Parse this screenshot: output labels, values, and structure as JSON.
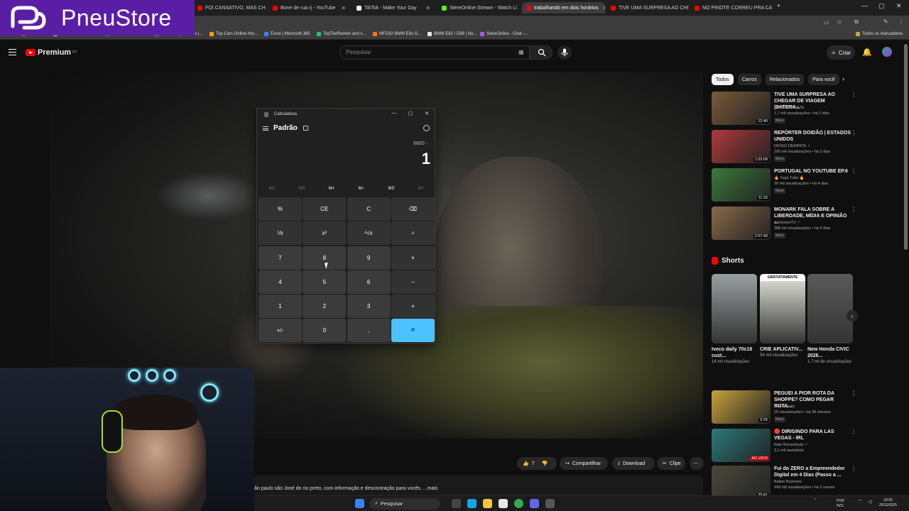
{
  "logo": {
    "text": "PneuStore"
  },
  "tabs": [
    {
      "label": "FOI CANSATIVO, MAS CHEGAM",
      "color": "#ff0000"
    },
    {
      "label": "Bone de rua rj - YouTube",
      "color": "#ff0000"
    },
    {
      "label": "TikTok - Make Your Day",
      "color": "#ffffff"
    },
    {
      "label": "StereOnline Stream - Watch Li",
      "color": "#53fc18"
    },
    {
      "label": "trabalhando em dois horários",
      "color": "#ff0000"
    },
    {
      "label": "TIVE UMA SURPRESA AO CHE",
      "color": "#ff0000"
    },
    {
      "label": "NO PINOTE CORREU PRA CASA",
      "color": "#ff0000"
    }
  ],
  "bookmarks": [
    {
      "label": "Gmail",
      "color": "#ea4335"
    },
    {
      "label": "FIAT-1085 Malas...",
      "color": "#cccccc"
    },
    {
      "label": "Li Mails v2.0 Fair ob...",
      "color": "#1a73e8"
    },
    {
      "label": "StreamingServices |...",
      "color": "#8b5cf6"
    },
    {
      "label": "Top Cars Online Hor...",
      "color": "#f59e0b"
    },
    {
      "label": "Excel | Microsoft 365",
      "color": "#3b82f6"
    },
    {
      "label": "TopTierRamen and s...",
      "color": "#22c55e"
    },
    {
      "label": "MFD32 BMW E8x G...",
      "color": "#f97316"
    },
    {
      "label": "BMW E82 / E88 | No...",
      "color": "#e5e7eb"
    },
    {
      "label": "StereOnline - Chat -...",
      "color": "#a855f7"
    }
  ],
  "bookmarks_all": "Todos os marcadores",
  "youtube": {
    "brand": "Premium",
    "region": "PT",
    "search_placeholder": "Pesquisar",
    "create_label": "Criar"
  },
  "calculator": {
    "title": "Calculadora",
    "mode": "Padrão",
    "expression": "6600 -",
    "display": "1",
    "memory": [
      {
        "label": "MC",
        "enabled": false
      },
      {
        "label": "MR",
        "enabled": false
      },
      {
        "label": "M+",
        "enabled": true
      },
      {
        "label": "M−",
        "enabled": true
      },
      {
        "label": "MS",
        "enabled": true
      },
      {
        "label": "M˅",
        "enabled": false
      }
    ],
    "keys": [
      {
        "label": "%",
        "name": "percent-key",
        "kind": "fn"
      },
      {
        "label": "CE",
        "name": "clear-entry-key",
        "kind": "fn"
      },
      {
        "label": "C",
        "name": "clear-key",
        "kind": "fn"
      },
      {
        "label": "⌫",
        "name": "backspace-key",
        "kind": "fn"
      },
      {
        "label": "⅟x",
        "name": "reciprocal-key",
        "kind": "fn"
      },
      {
        "label": "x²",
        "name": "square-key",
        "kind": "fn"
      },
      {
        "label": "²√x",
        "name": "sqrt-key",
        "kind": "fn"
      },
      {
        "label": "÷",
        "name": "divide-key",
        "kind": "fn"
      },
      {
        "label": "7",
        "name": "digit-7-key",
        "kind": "num"
      },
      {
        "label": "8",
        "name": "digit-8-key",
        "kind": "num"
      },
      {
        "label": "9",
        "name": "digit-9-key",
        "kind": "num"
      },
      {
        "label": "×",
        "name": "multiply-key",
        "kind": "fn"
      },
      {
        "label": "4",
        "name": "digit-4-key",
        "kind": "num"
      },
      {
        "label": "5",
        "name": "digit-5-key",
        "kind": "num"
      },
      {
        "label": "6",
        "name": "digit-6-key",
        "kind": "num"
      },
      {
        "label": "−",
        "name": "minus-key",
        "kind": "fn"
      },
      {
        "label": "1",
        "name": "digit-1-key",
        "kind": "num"
      },
      {
        "label": "2",
        "name": "digit-2-key",
        "kind": "num"
      },
      {
        "label": "3",
        "name": "digit-3-key",
        "kind": "num"
      },
      {
        "label": "+",
        "name": "plus-key",
        "kind": "fn"
      },
      {
        "label": "+/-",
        "name": "negate-key",
        "kind": "num"
      },
      {
        "label": "0",
        "name": "digit-0-key",
        "kind": "num"
      },
      {
        "label": ",",
        "name": "decimal-key",
        "kind": "num"
      },
      {
        "label": "=",
        "name": "equals-key",
        "kind": "eq"
      }
    ]
  },
  "video_actions": {
    "likes": "7",
    "share": "Compartilhar",
    "download": "Download",
    "clip": "Clipe"
  },
  "description": "ão paulo são José do rio preto, com informação e descontração para vocês.  ...mais",
  "chips": [
    "Todos",
    "Carros",
    "Relacionados",
    "Para você"
  ],
  "recommendations": [
    {
      "title": "TIVE UMA SURPRESA AO CHEGAR DE VIAGEM |BATERA...",
      "channel": "UM INSISTENTE",
      "meta": "1,7 mil visualizações • há 2 dias",
      "novo": "Novo",
      "duration": "12:40",
      "thumb": "#7a5a3a"
    },
    {
      "title": "REPÓRTER DOIDÃO | ESTADOS UNIDOS",
      "channel": "DIOGO DEFANTE ✓",
      "meta": "290 mil visualizações • há 2 dias",
      "novo": "Novo",
      "duration": "1:03:09",
      "thumb": "#b13a3a"
    },
    {
      "title": "PORTUGAL NO YOUTUBE EP.6",
      "channel": "🔥 Tuga Tube 🔥",
      "meta": "30 mil visualizações • há 4 dias",
      "novo": "Novo",
      "duration": "11:23",
      "thumb": "#3a7a3a"
    },
    {
      "title": "MONARK FALA SOBRE A LIBERDADE, MÍDIA E OPINIÃO ...",
      "channel": "AchismosTV ✓",
      "meta": "388 mil visualizações • há 5 dias",
      "novo": "Novo",
      "duration": "2:07:43",
      "thumb": "#8a6a4a"
    }
  ],
  "shorts_title": "Shorts",
  "shorts": [
    {
      "title": "Iveco daily 70c16 cust...",
      "views": "14 mil visualizações",
      "thumb": "#9aa0a0",
      "badge": ""
    },
    {
      "title": "CRIE APLICATIV...",
      "views": "94 mil visualizações",
      "thumb": "#e8e8e0",
      "badge": "GRATUITAMENTE"
    },
    {
      "title": "New Honda CIVIC 2026...",
      "views": "1,7 mi de visualizações",
      "thumb": "#5a5a5a",
      "badge": ""
    }
  ],
  "recommendations2": [
    {
      "title": "PEGUEI A PIOR ROTA DA SHOPPE? COMO PEGAR ROTA...",
      "channel": "Matheuscity",
      "meta": "20 visualizações • há 38 minutos",
      "novo": "Novo",
      "duration": "9:25",
      "thumb": "#c9a23a"
    },
    {
      "title": "🔴 DIRIGINDO PARA LAS VEGAS - IRL",
      "channel": "Rato Borrachudo ✓",
      "meta": "3,1 mil assistindo",
      "novo": "",
      "duration": "AO VIVO",
      "thumb": "#2a7a7a"
    },
    {
      "title": "Fui do ZERO a Empreendedor Digital em 4 Dias (Passo a ...",
      "channel": "Balian Business",
      "meta": "949 mil visualizações • há 2 meses",
      "novo": "",
      "duration": "29:41",
      "thumb": "#4a4a3a"
    }
  ],
  "taskbar": {
    "search": "Pesquisar",
    "lang_top": "POR",
    "lang_bottom": "INTL",
    "time": "18:05",
    "date": "25/10/2025"
  }
}
